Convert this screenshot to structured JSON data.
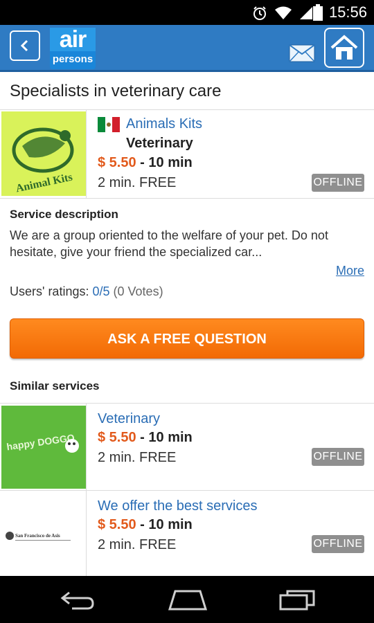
{
  "status_bar": {
    "time": "15:56",
    "icons": [
      "alarm-icon",
      "wifi-icon",
      "signal-icon",
      "battery-icon"
    ]
  },
  "header": {
    "back": "back-icon",
    "logo_top": "air",
    "logo_bottom": "persons",
    "mail": "mail-icon",
    "home": "home-icon"
  },
  "page_title": "Specialists in veterinary care",
  "main_service": {
    "provider": "Animals Kits",
    "flag": "mexico-flag-icon",
    "category": "Veterinary",
    "price": "$ 5.50",
    "duration": "- 10 min",
    "free": "2 min. FREE",
    "status": "OFFLINE",
    "logo_text": "Animal Kits"
  },
  "description": {
    "label": "Service description",
    "text": "We are a group oriented to the welfare of your pet. Do not hesitate, give your friend the specialized car...",
    "more": "More",
    "ratings_label": "Users' ratings:",
    "ratings_value": "0/5",
    "ratings_votes": "(0 Votes)"
  },
  "cta": {
    "label": "ASK A FREE QUESTION"
  },
  "similar": {
    "label": "Similar services",
    "items": [
      {
        "title": "Veterinary",
        "price": "$ 5.50",
        "duration": "- 10 min",
        "free": "2 min. FREE",
        "status": "OFFLINE",
        "logo_text": "happy DOGGO"
      },
      {
        "title": "We offer the best services",
        "price": "$ 5.50",
        "duration": "- 10 min",
        "free": "2 min. FREE",
        "status": "OFFLINE",
        "logo_text": "San Francisco de Asis"
      }
    ]
  },
  "nav": [
    "back-nav-icon",
    "home-nav-icon",
    "recents-nav-icon"
  ],
  "colors": {
    "header_blue": "#2f7bc3",
    "link_blue": "#2a6db5",
    "price_orange": "#e25a1c",
    "cta_orange": "#f47a10",
    "badge_gray": "#8f8f8f"
  }
}
